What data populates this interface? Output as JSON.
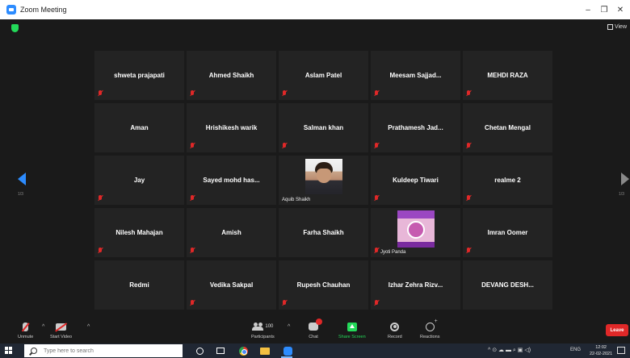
{
  "window": {
    "title": "Zoom Meeting",
    "controls": {
      "minimize": "–",
      "maximize": "❐",
      "close": "✕"
    }
  },
  "meeting": {
    "view_label": "View",
    "page_left": "1/3",
    "page_right": "1/3",
    "participants": [
      {
        "name": "shweta prajapati",
        "muted": true
      },
      {
        "name": "Ahmed Shaikh",
        "muted": true
      },
      {
        "name": "Aslam Patel",
        "muted": true
      },
      {
        "name": "Meesam  Sajjad...",
        "muted": true
      },
      {
        "name": "MEHDI RAZA",
        "muted": true
      },
      {
        "name": "Aman",
        "muted": false
      },
      {
        "name": "Hrishikesh warik",
        "muted": true
      },
      {
        "name": "Salman khan",
        "muted": true
      },
      {
        "name": "Prathamesh  Jad...",
        "muted": true
      },
      {
        "name": "Chetan Mengal",
        "muted": true
      },
      {
        "name": "Jay",
        "muted": true
      },
      {
        "name": "Sayed mohd has...",
        "muted": true
      },
      {
        "name": "Aquib Shaikh",
        "muted": false,
        "video": "person"
      },
      {
        "name": "Kuldeep Tiwari",
        "muted": true
      },
      {
        "name": "realme 2",
        "muted": true
      },
      {
        "name": "Nilesh Mahajan",
        "muted": true
      },
      {
        "name": "Amish",
        "muted": true
      },
      {
        "name": "Farha Shaikh",
        "muted": false
      },
      {
        "name": "Jyoti Panda",
        "muted": true,
        "video": "card"
      },
      {
        "name": "Imran Oomer",
        "muted": true
      },
      {
        "name": "Redmi",
        "muted": false
      },
      {
        "name": "Vedika Sakpal",
        "muted": true
      },
      {
        "name": "Rupesh Chauhan",
        "muted": true
      },
      {
        "name": "Izhar Zehra Rizv...",
        "muted": true
      },
      {
        "name": "DEVANG  DESH...",
        "muted": false
      }
    ]
  },
  "toolbar": {
    "unmute": "Unmute",
    "start_video": "Start Video",
    "participants": "Participants",
    "participants_count": "100",
    "chat": "Chat",
    "share_screen": "Share Screen",
    "record": "Record",
    "reactions": "Reactions",
    "leave": "Leave"
  },
  "taskbar": {
    "search_placeholder": "Type here to search",
    "tray_icons": "^ ⊙ ☁ ▬ ⌕ ▣ ◁)",
    "language": "ENG",
    "time": "12:02",
    "date": "22-02-2021"
  },
  "colors": {
    "accent": "#2d8cff",
    "muted_red": "#e02828",
    "share_green": "#23d959",
    "tile_bg": "#232323",
    "meeting_bg": "#1a1a1a"
  }
}
